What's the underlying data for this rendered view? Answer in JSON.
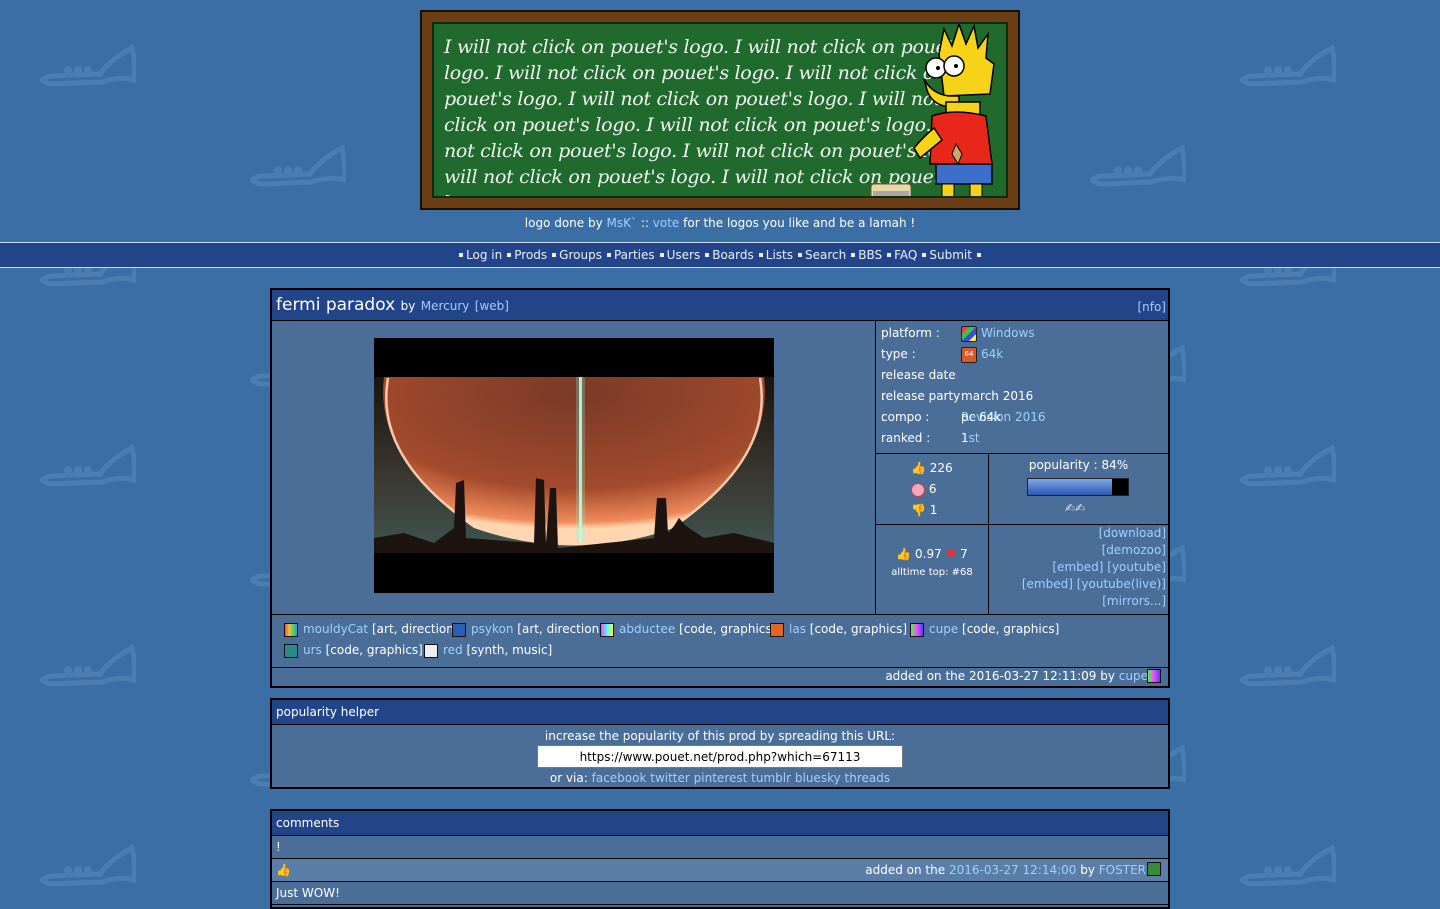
{
  "logo": {
    "chalk_text": "I will not click on pouet's logo. I will not click on pouet's logo. I will not click on pouet's logo. I will not click on pouet's logo. I will not click on pouet's logo. I will not click on pouet's logo. I will not click on pouet's logo. I will not click on pouet's logo. I will not click on pouet's logo. I will not click on pouet's logo. I will not click on pouet's logo.",
    "credit_prefix": "logo done by",
    "credit_author": "MsK`",
    "credit_sep": "::",
    "credit_vote": "vote",
    "credit_suffix": "for the logos you like and be a lamah !"
  },
  "nav": [
    "Log in",
    "Prods",
    "Groups",
    "Parties",
    "Users",
    "Boards",
    "Lists",
    "Search",
    "BBS",
    "FAQ",
    "Submit"
  ],
  "prod": {
    "title": "fermi paradox",
    "by": "by",
    "group": "Mercury",
    "web": "[web]",
    "nfo": "[nfo]",
    "info": [
      {
        "key": "platform :",
        "value": "Windows",
        "link": true,
        "icon": "windows-icon"
      },
      {
        "key": "type :",
        "value": "64k",
        "link": true,
        "icon": "64k-icon"
      },
      {
        "key": "release date :",
        "value": "march 2016",
        "link": false
      },
      {
        "key": "release party :",
        "value": "Revision 2016",
        "link": true
      },
      {
        "key": "compo :",
        "value": "pc 64k",
        "link": false
      },
      {
        "key": "ranked :",
        "value_prefix": "1",
        "value_link": "st"
      }
    ],
    "votes": {
      "rulez": "226",
      "piggie": "6",
      "sucks": "1"
    },
    "popularity": {
      "label": "popularity : 84%",
      "value": 0.84
    },
    "average": {
      "value": "0.97",
      "cdc": "7",
      "alltime": "alltime top: #68"
    },
    "links": {
      "download": "[download]",
      "demozoo": "[demozoo]",
      "embed1": "[embed]",
      "youtube": "[youtube]",
      "embed2": "[embed]",
      "youtube_live": "[youtube(live)]",
      "mirrors": "[mirrors...]"
    },
    "credits": [
      {
        "name": "mouldyCat",
        "role": "[art, direction]"
      },
      {
        "name": "psykon",
        "role": "[art, direction]"
      },
      {
        "name": "abductee",
        "role": "[code, graphics]"
      },
      {
        "name": "las",
        "role": "[code, graphics]"
      },
      {
        "name": "cupe",
        "role": "[code, graphics]"
      },
      {
        "name": "urs",
        "role": "[code, graphics]"
      },
      {
        "name": "red",
        "role": "[synth, music]"
      }
    ],
    "added": {
      "prefix": "added on the 2016-03-27 12:11:09 by",
      "user": "cupe"
    }
  },
  "helper": {
    "title": "popularity helper",
    "intro": "increase the popularity of this prod by spreading this URL:",
    "url": "https://www.pouet.net/prod.php?which=67113",
    "via": "or via:",
    "shares": [
      "facebook",
      "twitter",
      "pinterest",
      "tumblr",
      "bluesky",
      "threads"
    ]
  },
  "comments": {
    "title": "comments",
    "first_text": "!",
    "first_added_prefix": "added on the",
    "first_date": "2016-03-27 12:14:00",
    "first_by": "by",
    "first_user": "FOSTER",
    "second_text": "Just WOW!"
  },
  "colors": {
    "background": "#3a6ea5",
    "header": "#224488",
    "box": "#4a6e98",
    "link": "#9fcfff"
  }
}
